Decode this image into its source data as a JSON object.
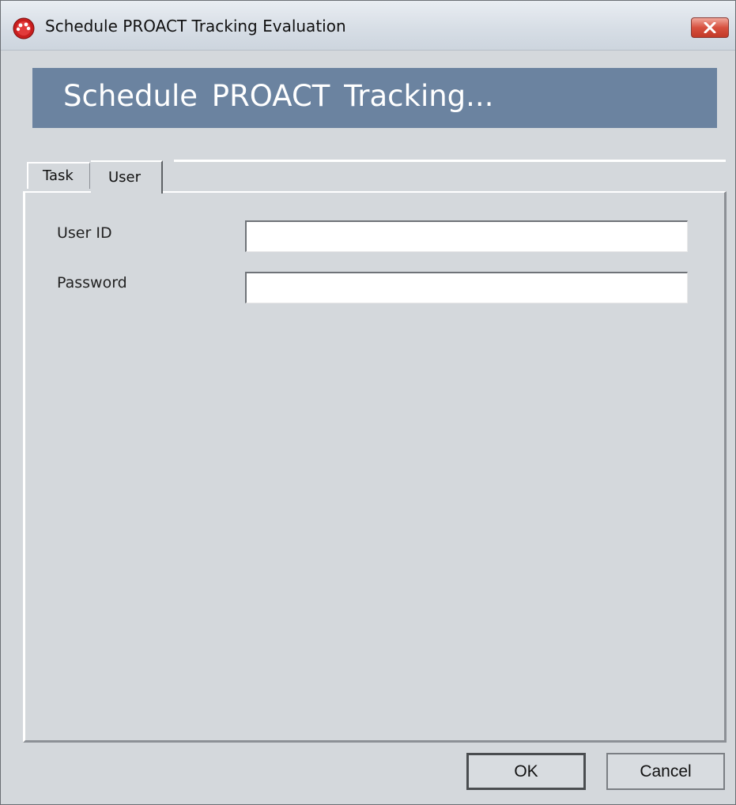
{
  "window": {
    "title": "Schedule PROACT Tracking Evaluation",
    "icon": "proact-app-icon",
    "close_icon": "close-icon"
  },
  "banner": {
    "title": "Schedule PROACT Tracking..."
  },
  "tabs": [
    {
      "label": "Task",
      "selected": false
    },
    {
      "label": "User",
      "selected": true
    }
  ],
  "user_tab": {
    "user_id_label": "User ID",
    "user_id_value": "",
    "password_label": "Password",
    "password_value": ""
  },
  "buttons": {
    "ok_label": "OK",
    "cancel_label": "Cancel"
  },
  "colors": {
    "dialog_background": "#d4d8dc",
    "banner_background": "#6b83a0",
    "banner_text": "#ffffff",
    "close_button": "#d04a38"
  }
}
